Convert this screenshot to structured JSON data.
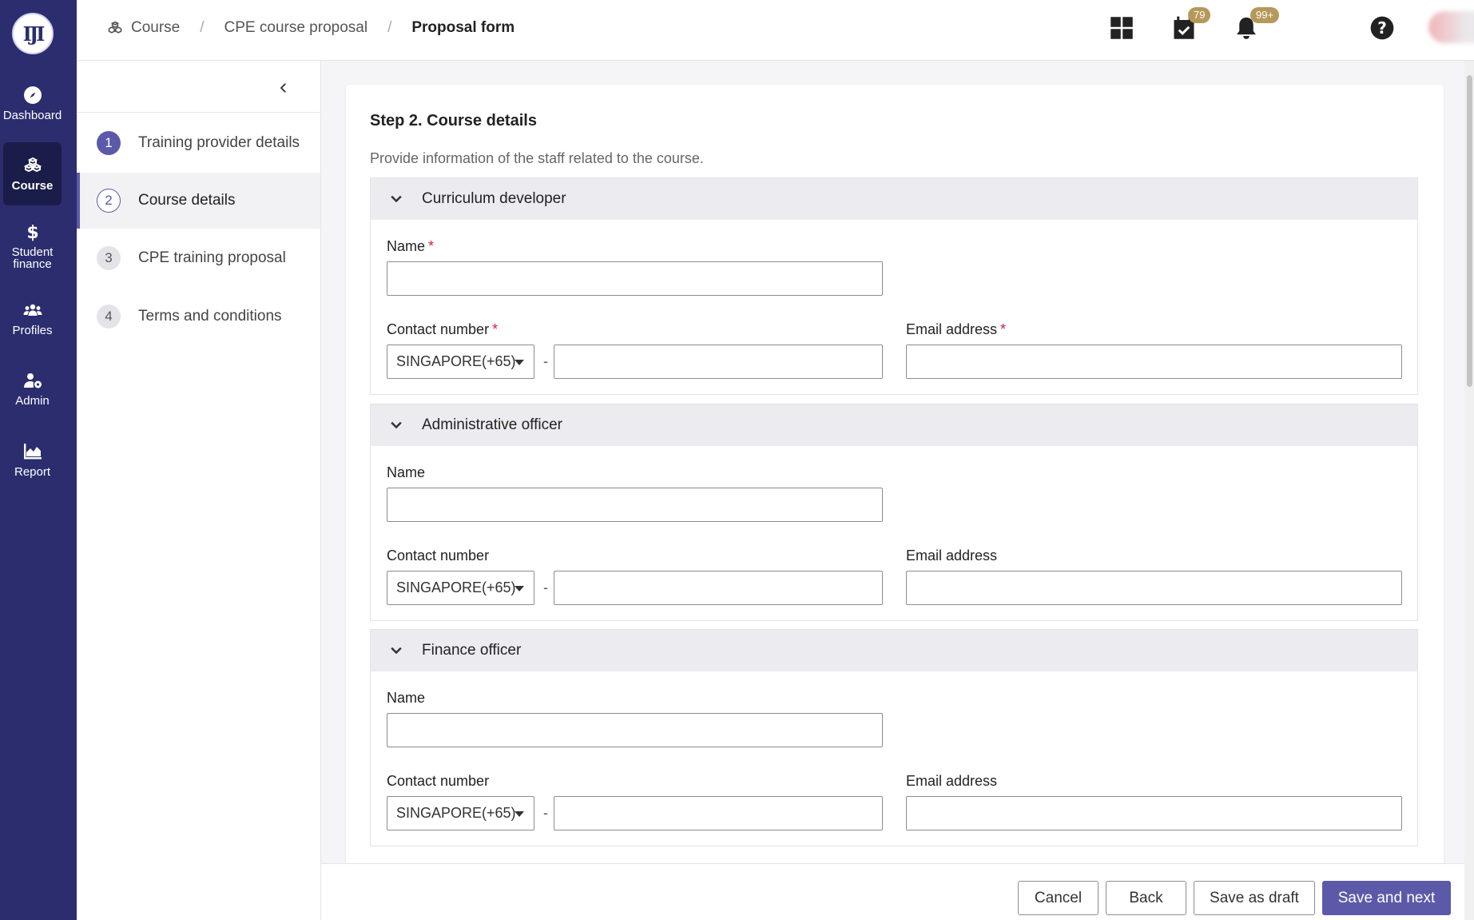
{
  "nav": {
    "logo_text": "IJI",
    "items": [
      {
        "label": "Dashboard",
        "icon": "compass-icon"
      },
      {
        "label": "Course",
        "icon": "cubes-icon"
      },
      {
        "label": "Student finance",
        "icon": "dollar-icon"
      },
      {
        "label": "Profiles",
        "icon": "users-icon"
      },
      {
        "label": "Admin",
        "icon": "user-gear-icon"
      },
      {
        "label": "Report",
        "icon": "area-chart-icon"
      }
    ],
    "active": "Course"
  },
  "header": {
    "breadcrumbs": [
      "Course",
      "CPE course proposal",
      "Proposal form"
    ],
    "tasks_badge": "79",
    "notifications_badge": "99+"
  },
  "steps": {
    "items": [
      {
        "number": "1",
        "label": "Training provider details",
        "state": "done"
      },
      {
        "number": "2",
        "label": "Course details",
        "state": "active"
      },
      {
        "number": "3",
        "label": "CPE training proposal",
        "state": "pending"
      },
      {
        "number": "4",
        "label": "Terms and conditions",
        "state": "pending"
      }
    ]
  },
  "form": {
    "title": "Step 2. Course details",
    "description": "Provide information of the staff related to the course.",
    "sections": [
      {
        "title": "Curriculum developer",
        "name_label": "Name",
        "name_value": "",
        "contact_label": "Contact number",
        "country_code": "SINGAPORE(+65)",
        "contact_value": "",
        "email_label": "Email address",
        "email_value": "",
        "required": true
      },
      {
        "title": "Administrative officer",
        "name_label": "Name",
        "name_value": "",
        "contact_label": "Contact number",
        "country_code": "SINGAPORE(+65)",
        "contact_value": "",
        "email_label": "Email address",
        "email_value": "",
        "required": false
      },
      {
        "title": "Finance officer",
        "name_label": "Name",
        "name_value": "",
        "contact_label": "Contact number",
        "country_code": "SINGAPORE(+65)",
        "contact_value": "",
        "email_label": "Email address",
        "email_value": "",
        "required": false
      }
    ],
    "required_marker": "*",
    "separator": "-"
  },
  "footer": {
    "cancel": "Cancel",
    "back": "Back",
    "save_draft": "Save as draft",
    "save_next": "Save and next"
  },
  "colors": {
    "rail": "#2b2d6e",
    "accent": "#5c5aa8",
    "badge": "#b5985a",
    "required": "#d0213a"
  }
}
